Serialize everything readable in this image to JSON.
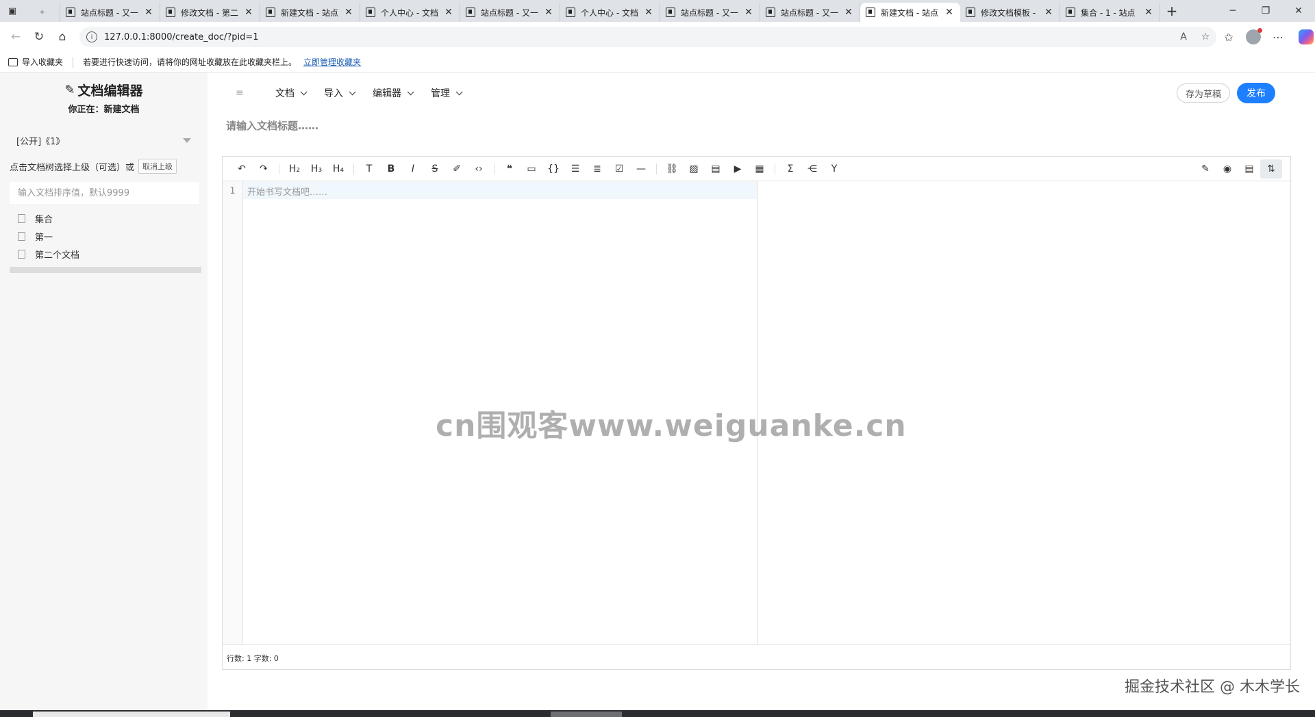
{
  "browser": {
    "tabs": [
      {
        "title": "站点标题 - 又一",
        "active": false
      },
      {
        "title": "修改文档 - 第二",
        "active": false
      },
      {
        "title": "新建文档 - 站点",
        "active": false
      },
      {
        "title": "个人中心 - 文档",
        "active": false
      },
      {
        "title": "站点标题 - 又一",
        "active": false
      },
      {
        "title": "个人中心 - 文档",
        "active": false
      },
      {
        "title": "站点标题 - 又一",
        "active": false
      },
      {
        "title": "站点标题 - 又一",
        "active": false
      },
      {
        "title": "新建文档 - 站点",
        "active": true
      },
      {
        "title": "修改文档模板 -",
        "active": false
      },
      {
        "title": "集合 - 1 - 站点",
        "active": false
      }
    ],
    "url": "127.0.0.1:8000/create_doc/?pid=1",
    "favorites_bar": {
      "import_label": "导入收藏夹",
      "hint": "若要进行快速访问，请将你的网址收藏放在此收藏夹栏上。",
      "manage_link": "立即管理收藏夹"
    }
  },
  "sidebar": {
    "app_title": "文档编辑器",
    "location": "你正在：新建文档",
    "scope_select": "[公开]《1》",
    "parent_hint": "点击文档树选择上级（可选）或",
    "cancel_parent": "取消上级",
    "sort_placeholder": "输入文档排序值，默认9999",
    "tree": [
      {
        "label": "集合"
      },
      {
        "label": "第一"
      },
      {
        "label": "第二个文档"
      }
    ]
  },
  "menubar": {
    "menus": [
      "文档",
      "导入",
      "编辑器",
      "管理"
    ],
    "save_draft": "存为草稿",
    "publish": "发布"
  },
  "editor": {
    "title_placeholder": "请输入文档标题……",
    "line_number": "1",
    "content_placeholder": "开始书写文档吧……",
    "status": "行数: 1 字数: 0",
    "toolbar_left": [
      "undo-icon",
      "redo-icon",
      "h2-icon",
      "h3-icon",
      "h4-icon",
      "font-icon",
      "bold-icon",
      "italic-icon",
      "strikethrough-icon",
      "highlight-icon",
      "code-icon",
      "quote-icon",
      "comment-icon",
      "inline-code-icon",
      "unordered-list-icon",
      "ordered-list-icon",
      "task-list-icon",
      "horizontal-rule-icon",
      "link-icon",
      "image-icon",
      "attachment-icon",
      "video-icon",
      "table-icon",
      "formula-icon",
      "mindmap-icon",
      "echarts-icon"
    ],
    "toolbar_right": [
      "edit-mode-icon",
      "preview-icon",
      "toc-icon",
      "sync-scroll-icon"
    ]
  },
  "overlays": {
    "watermark": "cn围观客www.weiguanke.cn",
    "credit": "掘金技术社区 @ 木木学长"
  }
}
